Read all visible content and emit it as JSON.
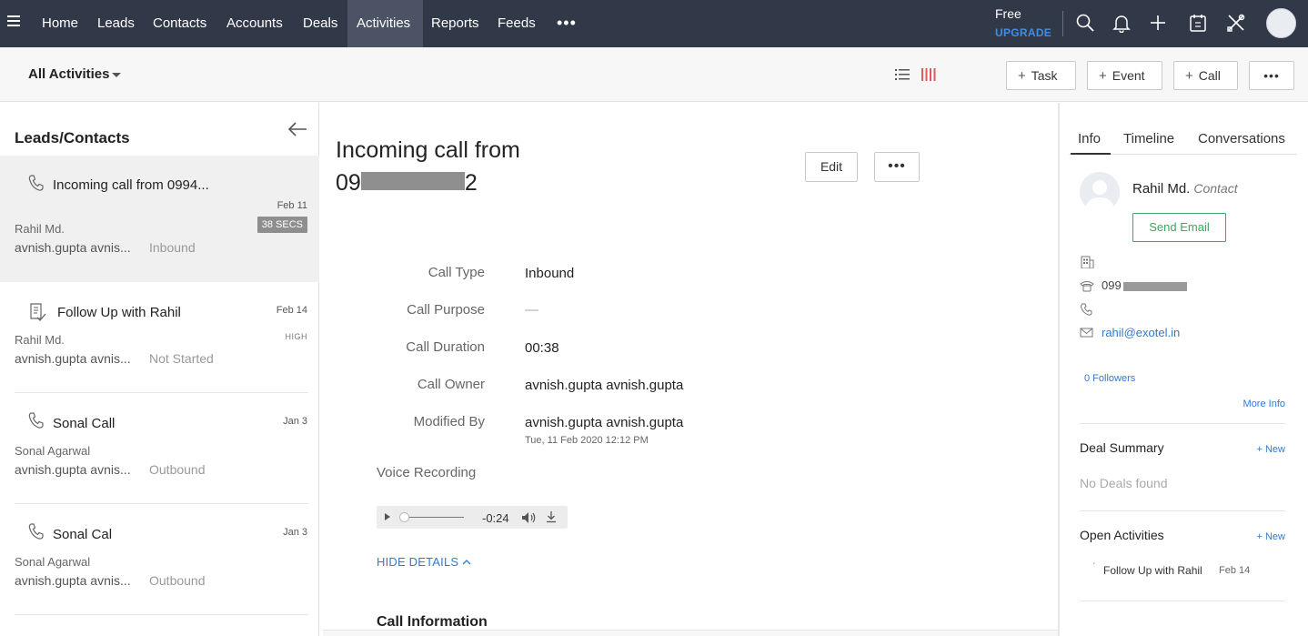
{
  "topnav": {
    "items": [
      "Home",
      "Leads",
      "Contacts",
      "Accounts",
      "Deals",
      "Activities",
      "Reports",
      "Feeds"
    ],
    "active": "Activities",
    "more": "•••",
    "free": "Free",
    "upgrade": "UPGRADE",
    "icons": [
      "search-icon",
      "bell-icon",
      "plus-icon",
      "calendar-icon",
      "tools-icon",
      "avatar"
    ]
  },
  "subhead": {
    "view_label": "All Activities",
    "buttons": {
      "task": "Task",
      "event": "Event",
      "call": "Call",
      "more": "•••"
    }
  },
  "left": {
    "title": "Leads/Contacts",
    "items": [
      {
        "title": "Incoming call from 0994...",
        "date": "Feb 11",
        "who": "Rahil Md.",
        "owner": "avnish.gupta avnis...",
        "status": "Inbound",
        "badge": "38 SECS",
        "icon": "phone-icon"
      },
      {
        "title": "Follow Up with Rahil",
        "date": "Feb 14",
        "who": "Rahil Md.",
        "owner": "avnish.gupta avnis...",
        "status": "Not Started",
        "priority": "HIGH",
        "icon": "task-icon"
      },
      {
        "title": "Sonal Call",
        "date": "Jan 3",
        "who": "Sonal Agarwal",
        "owner": "avnish.gupta avnis...",
        "status": "Outbound",
        "icon": "phone-icon"
      },
      {
        "title": "Sonal Cal",
        "date": "Jan 3",
        "who": "Sonal Agarwal",
        "owner": "avnish.gupta avnis...",
        "status": "Outbound",
        "icon": "phone-icon"
      }
    ]
  },
  "detail": {
    "title_line1": "Incoming call from",
    "title_prefix": "09",
    "title_suffix": "2",
    "edit": "Edit",
    "more": "•••",
    "fields": [
      {
        "label": "Call Type",
        "value": "Inbound"
      },
      {
        "label": "Call Purpose",
        "value": "—"
      },
      {
        "label": "Call Duration",
        "value": "00:38"
      },
      {
        "label": "Call Owner",
        "value": "avnish.gupta avnish.gupta"
      },
      {
        "label": "Modified By",
        "value": "avnish.gupta avnish.gupta",
        "sub": "Tue, 11 Feb 2020 12:12 PM"
      }
    ],
    "voice_label": "Voice Recording",
    "player_time": "-0:24",
    "player_progress": 0.0,
    "hide_details": "HIDE DETAILS",
    "section": "Call Information"
  },
  "right": {
    "tabs": [
      "Info",
      "Timeline",
      "Conversations"
    ],
    "active_tab": "Info",
    "name": "Rahil Md.",
    "type": "Contact",
    "send_email": "Send Email",
    "phone": "099",
    "email": "rahil@exotel.in",
    "followers": "0 Followers",
    "more_info": "More Info",
    "deal_summary": "Deal Summary",
    "deal_new": "+ New",
    "no_deals": "No Deals found",
    "open_activities": "Open Activities",
    "oa_new": "+ New",
    "oa_item_title": "Follow Up with Rahil",
    "oa_item_date": "Feb 14"
  },
  "colors": {
    "nav_bg": "#313949",
    "link": "#2f7ad4",
    "upgrade": "#3e8ee8",
    "send_email": "#3aa860",
    "kanban": "#e05a5a"
  }
}
